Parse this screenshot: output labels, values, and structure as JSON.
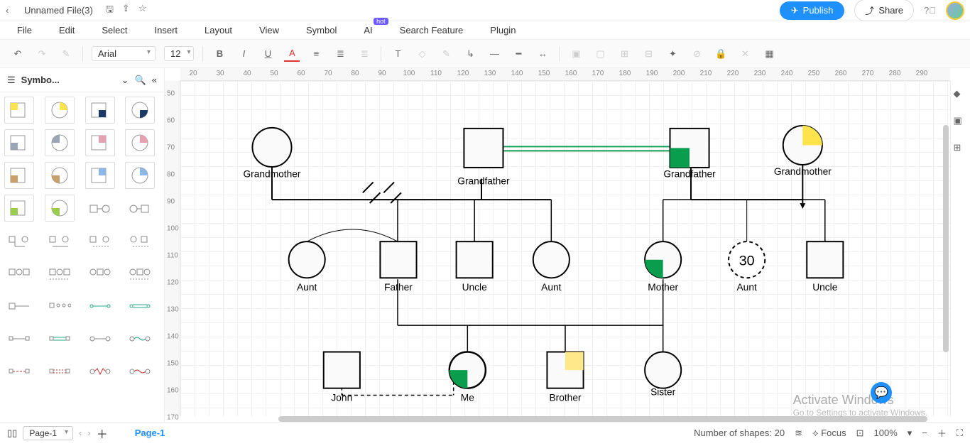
{
  "titlebar": {
    "filename": "Unnamed File(3)"
  },
  "header_buttons": {
    "publish": "Publish",
    "share": "Share"
  },
  "menubar": {
    "items": [
      {
        "label": "File"
      },
      {
        "label": "Edit"
      },
      {
        "label": "Select"
      },
      {
        "label": "Insert"
      },
      {
        "label": "Layout"
      },
      {
        "label": "View"
      },
      {
        "label": "Symbol"
      },
      {
        "label": "AI",
        "badge": "hot"
      },
      {
        "label": "Search Feature"
      },
      {
        "label": "Plugin"
      }
    ]
  },
  "toolbar": {
    "font": "Arial",
    "size": "12"
  },
  "sidebar": {
    "title": "Symbo..."
  },
  "ruler_h": [
    "20",
    "30",
    "40",
    "50",
    "60",
    "70",
    "80",
    "90",
    "100",
    "110",
    "120",
    "130",
    "140",
    "150",
    "160",
    "170",
    "180",
    "190",
    "200",
    "210",
    "220",
    "230",
    "240",
    "250",
    "260",
    "270",
    "280",
    "290"
  ],
  "ruler_v": [
    "50",
    "60",
    "70",
    "80",
    "90",
    "100",
    "110",
    "120",
    "130",
    "140",
    "150",
    "160",
    "170"
  ],
  "nodes": {
    "gm1": "Grandmother",
    "gf1": "Grandfather",
    "gf2": "Grandfather",
    "gm2": "Grandmother",
    "aunt1": "Aunt",
    "father": "Father",
    "uncle1": "Uncle",
    "aunt2": "Aunt",
    "mother": "Mother",
    "aunt3": "Aunt",
    "aunt3_age": "30",
    "uncle2": "Uncle",
    "john": "John",
    "me": "Me",
    "brother": "Brother",
    "sister": "Sister"
  },
  "pagebar": {
    "page_thumb_label": "Page-1",
    "page_tab_label": "Page-1",
    "shape_count": "Number of shapes: 20",
    "focus_label": "Focus",
    "zoom": "100%"
  },
  "watermark": {
    "line1": "Activate Windows",
    "line2": "Go to Settings to activate Windows."
  }
}
